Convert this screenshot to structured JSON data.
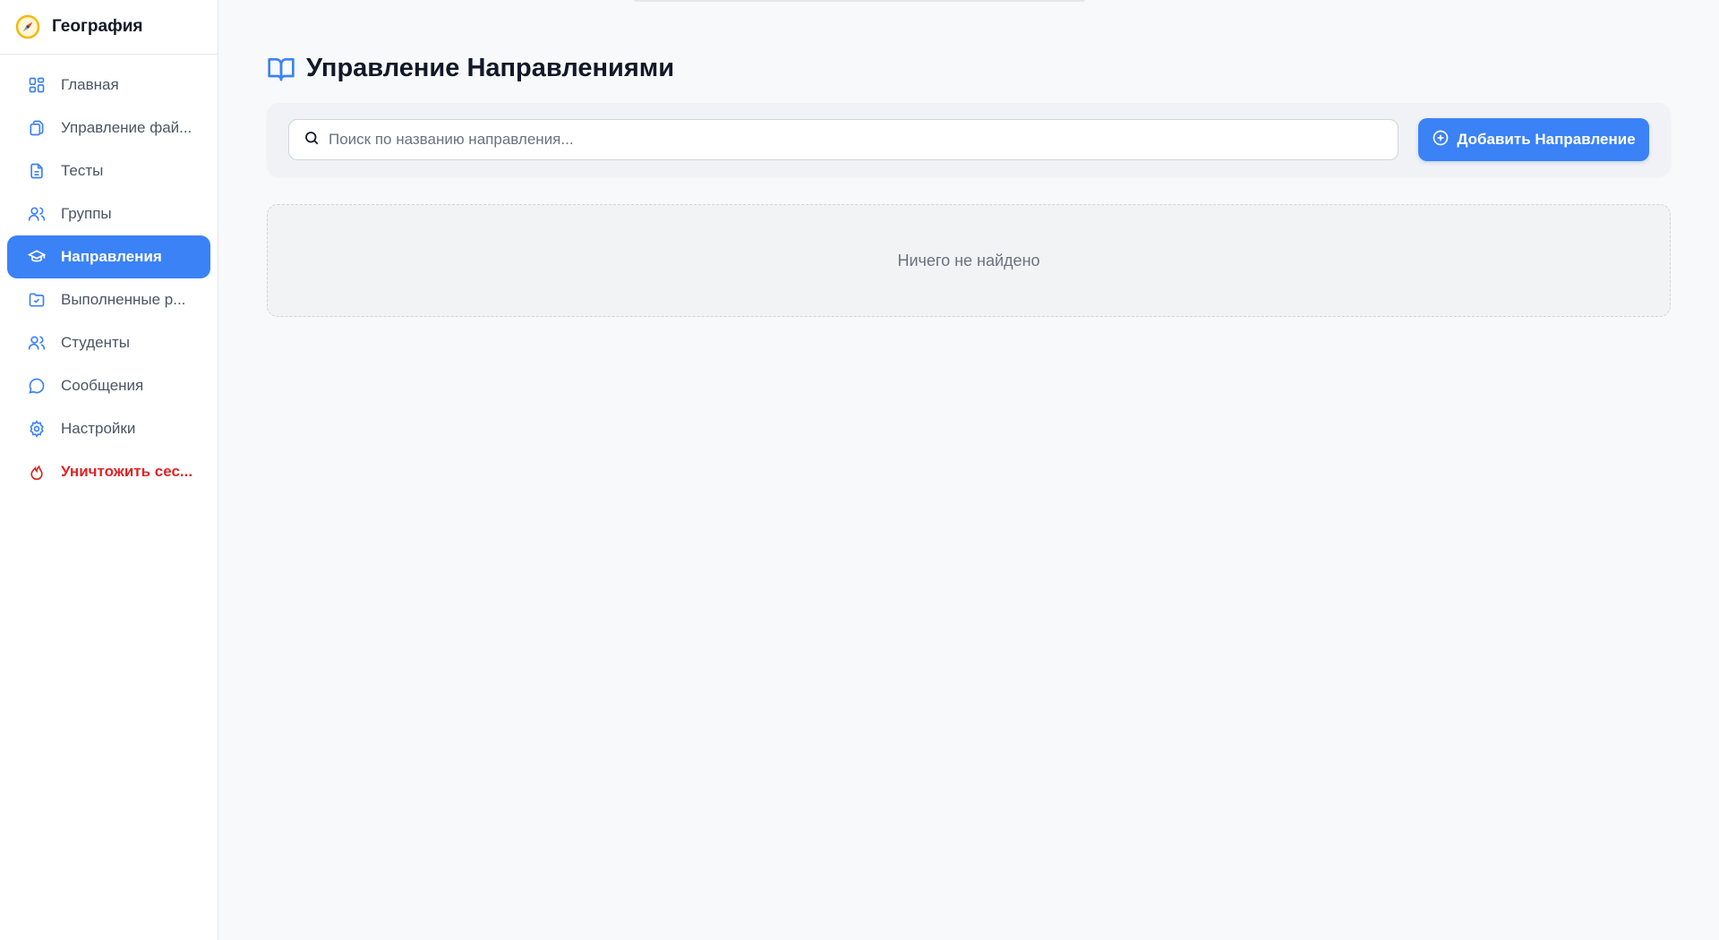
{
  "app": {
    "title": "География",
    "logo_icon": "compass-icon"
  },
  "sidebar": {
    "items": [
      {
        "label": "Главная",
        "icon": "dashboard-icon",
        "active": false
      },
      {
        "label": "Управление фай...",
        "icon": "files-icon",
        "active": false
      },
      {
        "label": "Тесты",
        "icon": "document-icon",
        "active": false
      },
      {
        "label": "Группы",
        "icon": "users-icon",
        "active": false
      },
      {
        "label": "Направления",
        "icon": "graduation-cap-icon",
        "active": true
      },
      {
        "label": "Выполненные р...",
        "icon": "folder-check-icon",
        "active": false
      },
      {
        "label": "Студенты",
        "icon": "users-icon",
        "active": false
      },
      {
        "label": "Сообщения",
        "icon": "message-icon",
        "active": false
      },
      {
        "label": "Настройки",
        "icon": "gear-icon",
        "active": false
      },
      {
        "label": "Уничтожить сес...",
        "icon": "flame-icon",
        "active": false,
        "danger": true
      }
    ]
  },
  "main": {
    "title": "Управление Направлениями",
    "title_icon": "book-open-icon",
    "search": {
      "placeholder": "Поиск по названию направления...",
      "value": ""
    },
    "add_button": {
      "label": "Добавить Направление",
      "icon": "plus-circle-icon"
    },
    "empty_state": "Ничего не найдено"
  },
  "colors": {
    "accent": "#3b82f6",
    "danger": "#dc2626",
    "background": "#f8f9fb",
    "sidebar": "#ffffff"
  }
}
